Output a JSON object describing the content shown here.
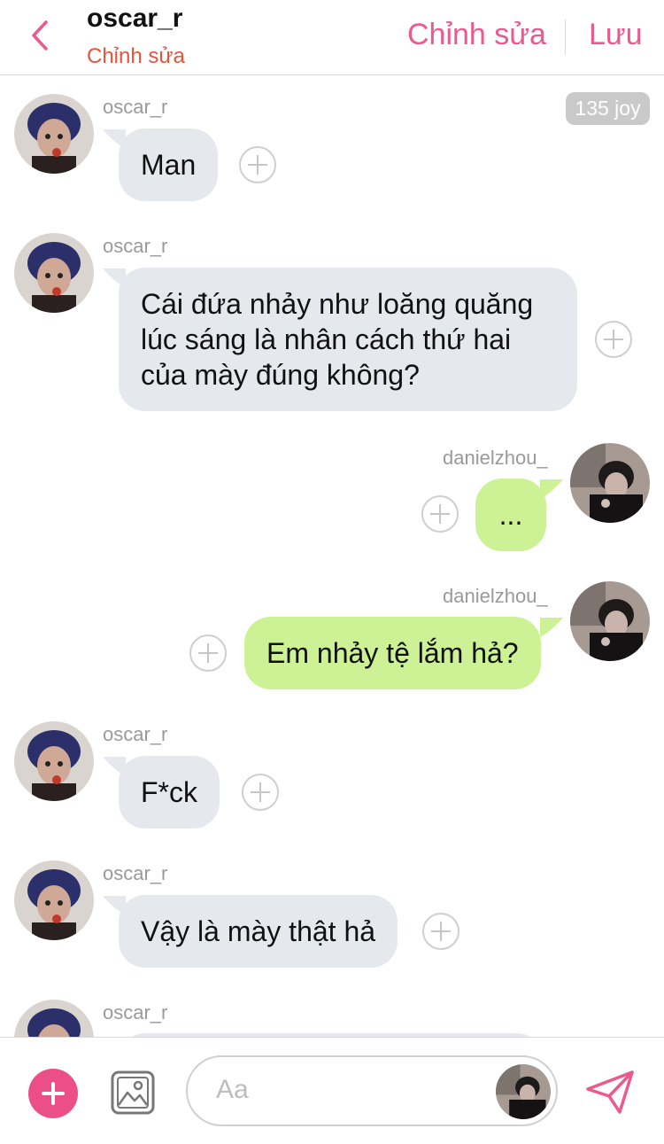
{
  "header": {
    "title": "oscar_r",
    "subtitle": "Chỉnh sửa",
    "edit_label": "Chỉnh sửa",
    "save_label": "Lưu"
  },
  "joy_badge": "135 joy",
  "messages": [
    {
      "side": "left",
      "name": "oscar_r",
      "text": "Man"
    },
    {
      "side": "left",
      "name": "oscar_r",
      "lines": [
        "Cái đứa nhảy như loăng quăng",
        "lúc sáng là nhân cách thứ hai",
        "của mày đúng không?"
      ]
    },
    {
      "side": "right",
      "name": "danielzhou_",
      "text": "..."
    },
    {
      "side": "right",
      "name": "danielzhou_",
      "text": "Em nhảy tệ lắm hả?"
    },
    {
      "side": "left",
      "name": "oscar_r",
      "text": "F*ck"
    },
    {
      "side": "left",
      "name": "oscar_r",
      "text": "Vậy là mày thật hả"
    },
    {
      "side": "left",
      "name": "oscar_r",
      "text": ""
    }
  ],
  "composer": {
    "placeholder": "Aa"
  },
  "colors": {
    "accent": "#ea5a8d",
    "subtitle": "#e8533b",
    "bubble_left": "#e5e8ed",
    "bubble_right": "#cdf195"
  },
  "icons": [
    "back-chevron-icon",
    "plus-circle-icon",
    "add-icon",
    "image-icon",
    "send-icon"
  ]
}
